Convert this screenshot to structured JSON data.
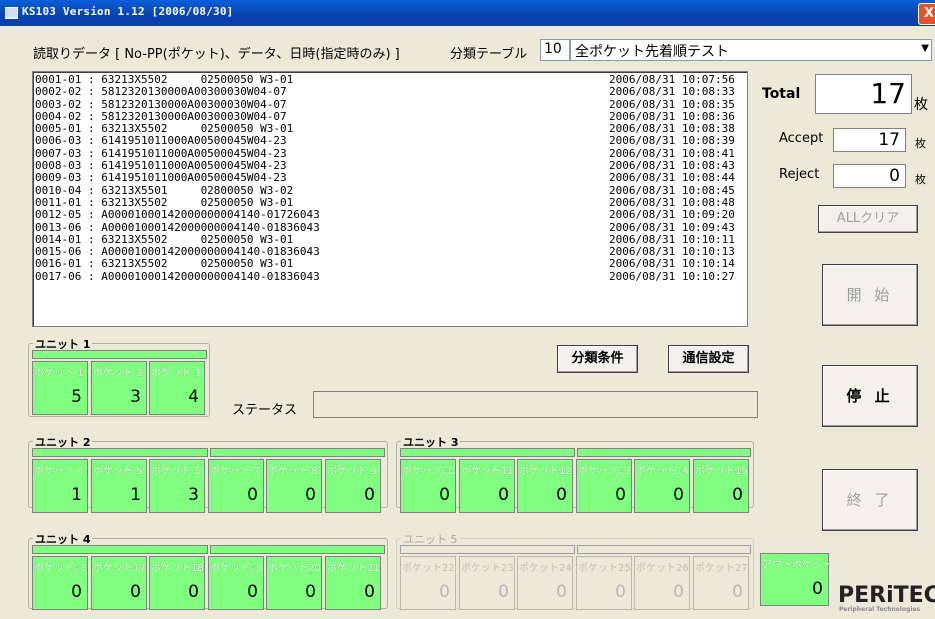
{
  "window": {
    "title": "KS103 Version 1.12 [2006/08/30]",
    "close_glyph": "X"
  },
  "header": {
    "read_data_label": "読取りデータ [ No-PP(ポケット)、データ、日時(指定時のみ) ]",
    "class_table_label": "分類テーブル",
    "class_table_no": "10",
    "class_table_name": "全ポケット先着順テスト",
    "dropdown_icon": "chevron-down-icon"
  },
  "log": [
    {
      "d": "0001-01 : 63213X5502     02500050 W3-01",
      "t": "2006/08/31 10:07:56"
    },
    {
      "d": "0002-02 : 5812320130000A00300030W04-07",
      "t": "2006/08/31 10:08:33"
    },
    {
      "d": "0003-02 : 5812320130000A00300030W04-07",
      "t": "2006/08/31 10:08:35"
    },
    {
      "d": "0004-02 : 5812320130000A00300030W04-07",
      "t": "2006/08/31 10:08:36"
    },
    {
      "d": "0005-01 : 63213X5502     02500050 W3-01",
      "t": "2006/08/31 10:08:38"
    },
    {
      "d": "0006-03 : 6141951011000A00500045W04-23",
      "t": "2006/08/31 10:08:39"
    },
    {
      "d": "0007-03 : 6141951011000A00500045W04-23",
      "t": "2006/08/31 10:08:41"
    },
    {
      "d": "0008-03 : 6141951011000A00500045W04-23",
      "t": "2006/08/31 10:08:43"
    },
    {
      "d": "0009-03 : 6141951011000A00500045W04-23",
      "t": "2006/08/31 10:08:44"
    },
    {
      "d": "0010-04 : 63213X5501     02800050 W3-02",
      "t": "2006/08/31 10:08:45"
    },
    {
      "d": "0011-01 : 63213X5502     02500050 W3-01",
      "t": "2006/08/31 10:08:48"
    },
    {
      "d": "0012-05 : A00001000142000000004140-01726043",
      "t": "2006/08/31 10:09:20"
    },
    {
      "d": "0013-06 : A00001000142000000004140-01836043",
      "t": "2006/08/31 10:09:43"
    },
    {
      "d": "0014-01 : 63213X5502     02500050 W3-01",
      "t": "2006/08/31 10:10:11"
    },
    {
      "d": "0015-06 : A00001000142000000004140-01836043",
      "t": "2006/08/31 10:10:13"
    },
    {
      "d": "0016-01 : 63213X5502     02500050 W3-01",
      "t": "2006/08/31 10:10:14"
    },
    {
      "d": "0017-06 : A00001000142000000004140-01836043",
      "t": "2006/08/31 10:10:27"
    }
  ],
  "counters": {
    "total_label": "Total",
    "total": "17",
    "total_unit": "枚",
    "accept_label": "Accept",
    "accept": "17",
    "accept_unit": "枚",
    "reject_label": "Reject",
    "reject": "0",
    "reject_unit": "枚"
  },
  "buttons": {
    "all_clear": "ALLクリア",
    "start": "開 始",
    "stop": "停 止",
    "exit": "終 了",
    "class_conditions": "分類条件",
    "comm_settings": "通信設定"
  },
  "status": {
    "label": "ステータス",
    "value": ""
  },
  "units": {
    "u1": {
      "label": "ユニット 1",
      "pockets": [
        {
          "name": "ポケット 1",
          "count": "5"
        },
        {
          "name": "ポケット 2",
          "count": "3"
        },
        {
          "name": "ポケット 3",
          "count": "4"
        }
      ]
    },
    "u2": {
      "label": "ユニット 2",
      "pockets": [
        {
          "name": "ポケット 4",
          "count": "1"
        },
        {
          "name": "ポケット 5",
          "count": "1"
        },
        {
          "name": "ポケット 6",
          "count": "3"
        },
        {
          "name": "ポケット 7",
          "count": "0"
        },
        {
          "name": "ポケット 8",
          "count": "0"
        },
        {
          "name": "ポケット 9",
          "count": "0"
        }
      ]
    },
    "u3": {
      "label": "ユニット 3",
      "pockets": [
        {
          "name": "ポケット10",
          "count": "0"
        },
        {
          "name": "ポケット11",
          "count": "0"
        },
        {
          "name": "ポケット12",
          "count": "0"
        },
        {
          "name": "ポケット13",
          "count": "0"
        },
        {
          "name": "ポケット14",
          "count": "0"
        },
        {
          "name": "ポケット15",
          "count": "0"
        }
      ]
    },
    "u4": {
      "label": "ユニット 4",
      "pockets": [
        {
          "name": "ポケット16",
          "count": "0"
        },
        {
          "name": "ポケット17",
          "count": "0"
        },
        {
          "name": "ポケット18",
          "count": "0"
        },
        {
          "name": "ポケット19",
          "count": "0"
        },
        {
          "name": "ポケット20",
          "count": "0"
        },
        {
          "name": "ポケット21",
          "count": "0"
        }
      ]
    },
    "u5": {
      "label": "ユニット 5",
      "pockets": [
        {
          "name": "ポケット22",
          "count": "0"
        },
        {
          "name": "ポケット23",
          "count": "0"
        },
        {
          "name": "ポケット24",
          "count": "0"
        },
        {
          "name": "ポケット25",
          "count": "0"
        },
        {
          "name": "ポケット26",
          "count": "0"
        },
        {
          "name": "ポケット27",
          "count": "0"
        }
      ]
    },
    "out": {
      "name": "アウトポケット",
      "count": "0"
    }
  },
  "logo": {
    "main": "PERiTEC",
    "sub": "Peripheral Technologies"
  },
  "colors": {
    "pocket_active": "#80ff80",
    "titlebar": "#0842b0",
    "window_bg": "#ece9d8"
  }
}
